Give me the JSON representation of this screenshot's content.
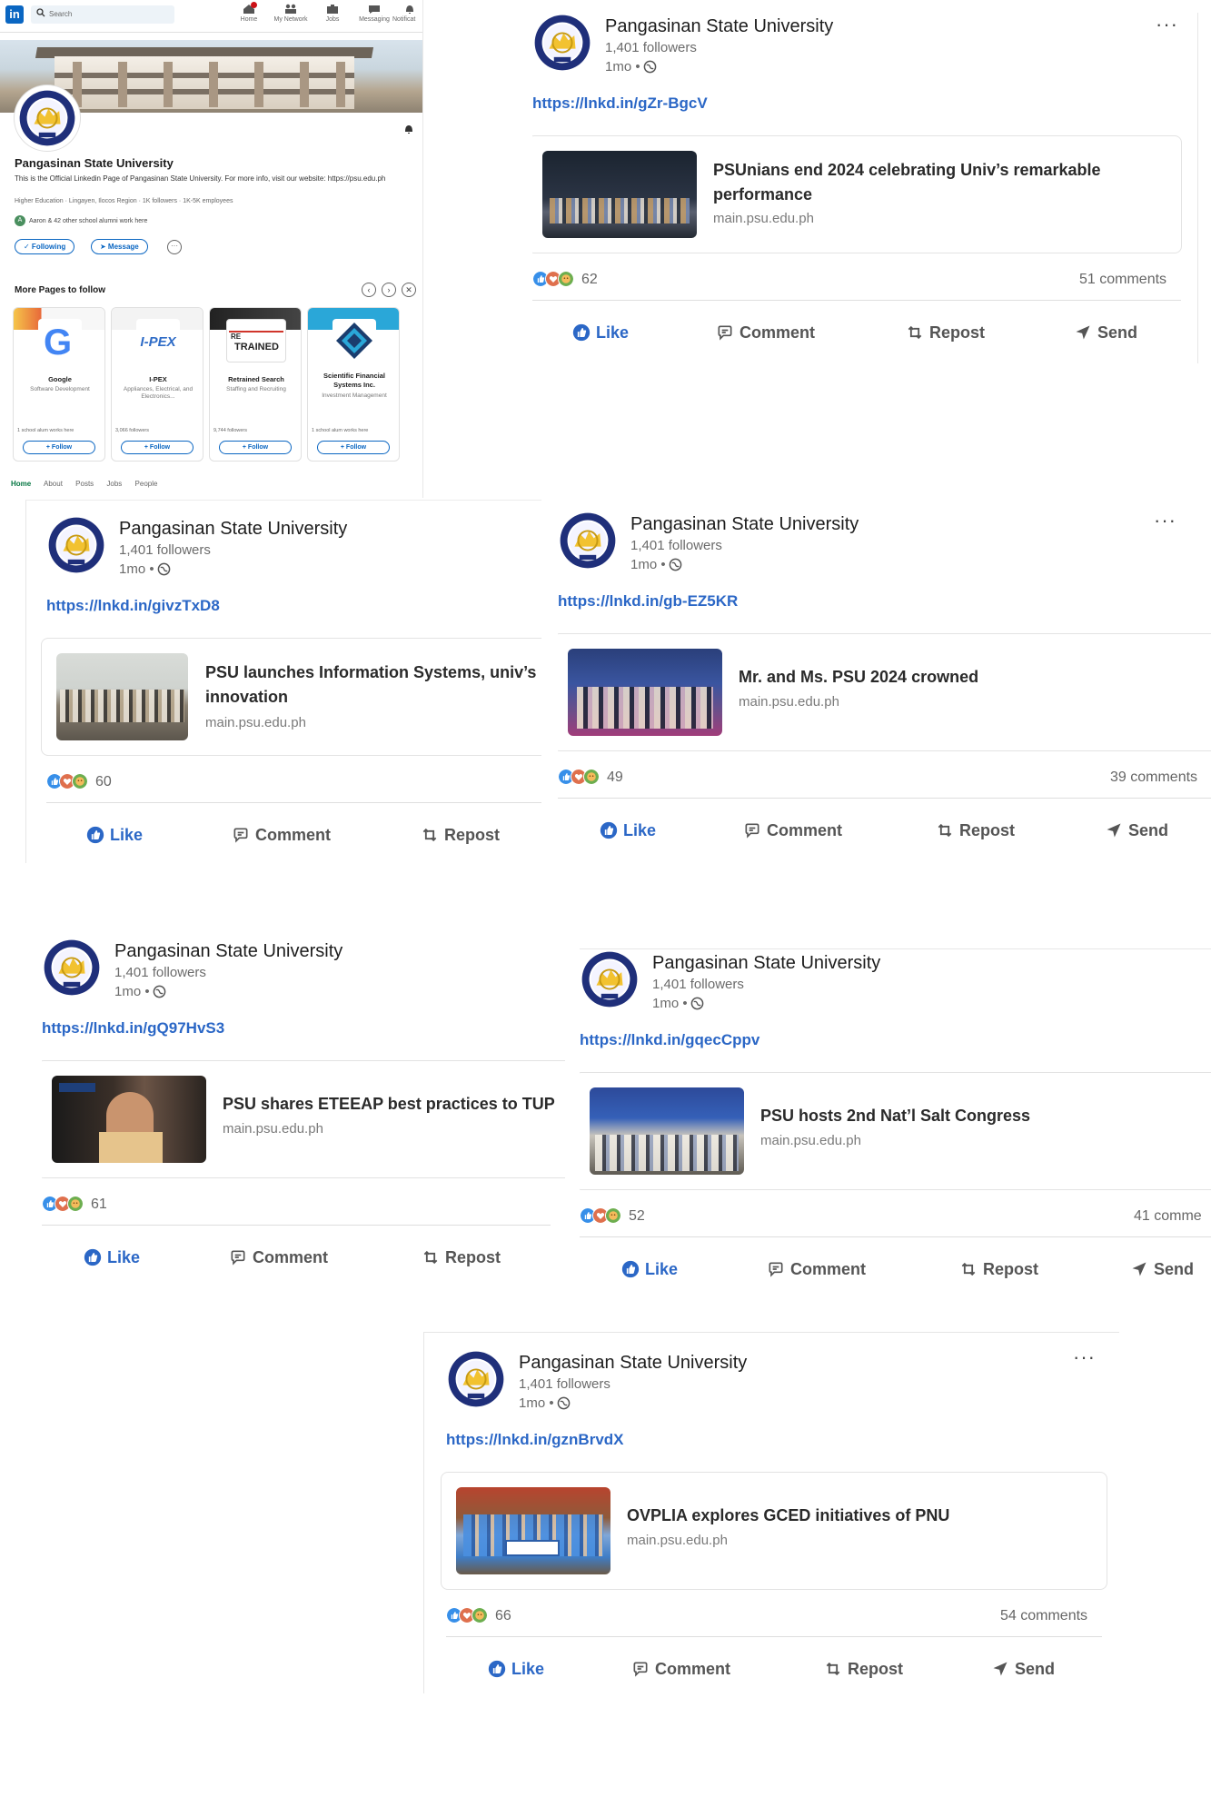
{
  "topbar": {
    "logo": "in",
    "search_placeholder": "Search",
    "nav": [
      {
        "label": "Home",
        "icon": "home-icon"
      },
      {
        "label": "My Network",
        "icon": "network-icon"
      },
      {
        "label": "Jobs",
        "icon": "briefcase-icon"
      },
      {
        "label": "Messaging",
        "icon": "chat-icon"
      },
      {
        "label": "Notificat",
        "icon": "bell-icon"
      }
    ]
  },
  "org": {
    "name": "Pangasinan State University",
    "description": "This is the Official Linkedin Page of Pangasinan State University. For more info, visit our website: https://psu.edu.ph",
    "meta": "Higher Education · Lingayen, Ilocos Region · 1K followers · 1K-5K employees",
    "alumni": "Aaron & 42 other school alumni work here",
    "alumni_initial": "A",
    "following_label": "✓ Following",
    "message_label": "➤ Message",
    "more_label": "···"
  },
  "more_pages": {
    "title": "More Pages to follow",
    "prev": "‹",
    "next": "›",
    "close": "✕",
    "cards": [
      {
        "name": "Google",
        "industry": "Software Development",
        "followers": "1 school alum works here",
        "follow": "+ Follow"
      },
      {
        "name": "I-PEX",
        "industry": "Appliances, Electrical, and Electronics...",
        "followers": "3,066 followers",
        "follow": "+ Follow"
      },
      {
        "name": "Retrained Search",
        "industry": "Staffing and Recruiting",
        "followers": "9,744 followers",
        "follow": "+ Follow"
      },
      {
        "name": "Scientific Financial Systems Inc.",
        "industry": "Investment Management",
        "followers": "1 school alum works here",
        "follow": "+ Follow"
      }
    ],
    "logo_text": {
      "google": "G",
      "ipex": "I-PEX",
      "retrained": "TRAINED",
      "retrained_small": "RE"
    }
  },
  "subnav": [
    "Home",
    "About",
    "Posts",
    "Jobs",
    "People"
  ],
  "post_common": {
    "author": "Pangasinan State University",
    "followers": "1,401 followers",
    "time": "1mo •",
    "more": "···",
    "like": "Like",
    "comment": "Comment",
    "repost": "Repost",
    "send": "Send"
  },
  "posts": [
    {
      "link": "https://lnkd.in/gZr-BgcV",
      "title_1": "PSUnians end 2024 celebrating Univ’s remarkable",
      "title_2": "performance",
      "domain": "main.psu.edu.ph",
      "reactions": "62",
      "comments": "51 comments"
    },
    {
      "link": "https://lnkd.in/givzTxD8",
      "title_1": "PSU launches Information Systems, univ’s qu",
      "title_2": "innovation",
      "domain": "main.psu.edu.ph",
      "reactions": "60",
      "comments": ""
    },
    {
      "link": "https://lnkd.in/gb-EZ5KR",
      "title_1": "Mr. and Ms. PSU 2024 crowned",
      "title_2": "",
      "domain": "main.psu.edu.ph",
      "reactions": "49",
      "comments": "39 comments"
    },
    {
      "link": "https://lnkd.in/gQ97HvS3",
      "title_1": "PSU shares ETEEAP best practices to TUP",
      "title_2": "",
      "domain": "main.psu.edu.ph",
      "reactions": "61",
      "comments": ""
    },
    {
      "link": "https://lnkd.in/gqecCppv",
      "title_1": "PSU hosts 2nd Nat’l Salt Congress",
      "title_2": "",
      "domain": "main.psu.edu.ph",
      "reactions": "52",
      "comments": "41 comme"
    },
    {
      "link": "https://lnkd.in/gznBrvdX",
      "title_1": "OVPLIA explores GCED initiatives of PNU",
      "title_2": "",
      "domain": "main.psu.edu.ph",
      "reactions": "66",
      "comments": "54 comments"
    }
  ],
  "colors": {
    "linkedin_blue": "#0a66c2",
    "link_blue": "#2b67c6",
    "psu_navy": "#1f2f7a",
    "psu_gold": "#f2c230"
  }
}
